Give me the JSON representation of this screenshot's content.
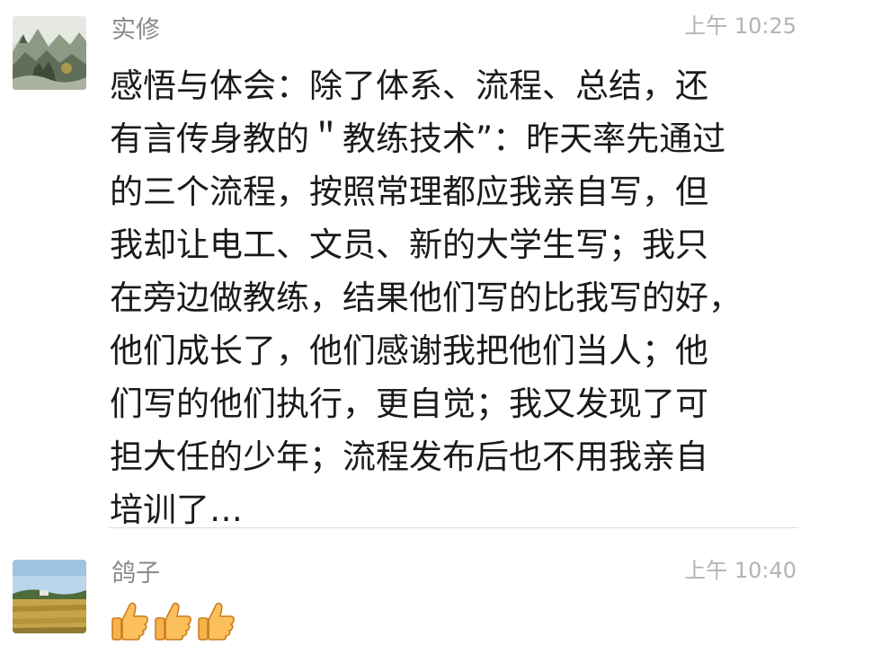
{
  "messages": [
    {
      "sender": "实修",
      "time": "上午 10:25",
      "avatar_icon": "landscape-painting-avatar",
      "lines": [
        "感悟与体会：除了体系、流程、总结，还",
        "有言传身教的＂教练技术”：昨天率先通过",
        "的三个流程，按照常理都应我亲自写，但",
        "我却让电工、文员、新的大学生写；我只",
        "在旁边做教练，结果他们写的比我写的好，",
        "他们成长了，他们感谢我把他们当人；他",
        "们写的他们执行，更自觉；我又发现了可",
        "担大任的少年；流程发布后也不用我亲自",
        "培训了…"
      ]
    },
    {
      "sender": "鸽子",
      "time": "上午 10:40",
      "avatar_icon": "field-landscape-avatar",
      "reaction_icons": [
        "thumbs-up-icon",
        "thumbs-up-icon",
        "thumbs-up-icon"
      ]
    }
  ],
  "colors": {
    "name": "#8a8a8a",
    "time": "#b3b3b3",
    "text": "#1a1a1a",
    "divider": "#dcdcdc",
    "thumb": "#f5a623"
  }
}
